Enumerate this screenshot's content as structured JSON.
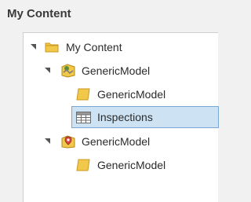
{
  "panel": {
    "title": "My Content"
  },
  "tree": {
    "root": {
      "label": "My Content",
      "icon": "folder-icon",
      "expanded": true
    },
    "model1": {
      "label": "GenericModel",
      "icon": "feature-service-icon",
      "expanded": true
    },
    "model1_layer": {
      "label": "GenericModel",
      "icon": "polygon-layer-icon"
    },
    "inspections": {
      "label": "Inspections",
      "icon": "table-icon",
      "selected": true
    },
    "model2": {
      "label": "GenericModel",
      "icon": "map-pin-service-icon",
      "expanded": true
    },
    "model2_layer": {
      "label": "GenericModel",
      "icon": "polygon-layer-icon"
    }
  },
  "colors": {
    "selection_fill": "#cde3f4",
    "selection_border": "#7ba7d4",
    "folder_yellow": "#f2c84b",
    "panel_bg": "#ffffff"
  }
}
